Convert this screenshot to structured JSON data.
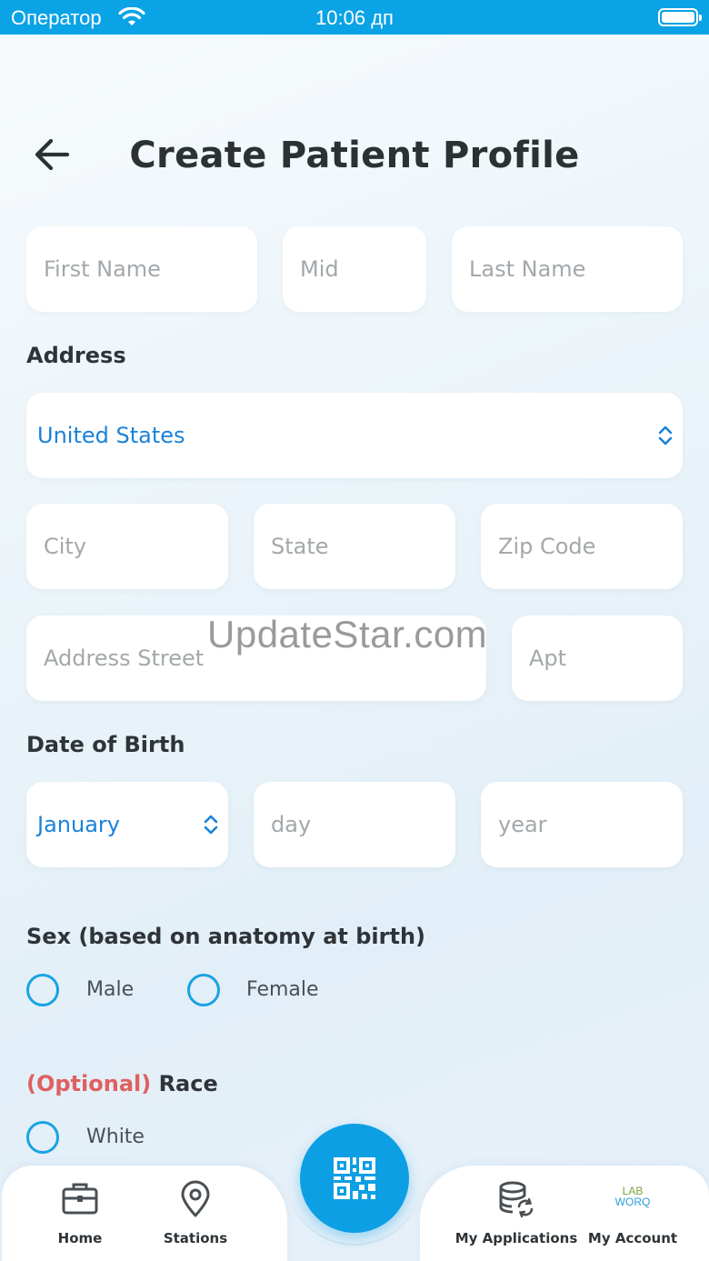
{
  "status_bar": {
    "carrier": "Оператор",
    "time": "10:06 дп"
  },
  "header": {
    "title": "Create Patient Profile"
  },
  "name_fields": {
    "first_name_placeholder": "First Name",
    "middle_placeholder": "Mid",
    "last_name_placeholder": "Last Name"
  },
  "address": {
    "label": "Address",
    "country_selected": "United States",
    "city_placeholder": "City",
    "state_placeholder": "State",
    "zip_placeholder": "Zip Code",
    "street_placeholder": "Address Street",
    "apt_placeholder": "Apt"
  },
  "dob": {
    "label": "Date of Birth",
    "month_selected": "January",
    "day_placeholder": "day",
    "year_placeholder": "year"
  },
  "sex": {
    "label": "Sex (based on anatomy at birth)",
    "options": [
      "Male",
      "Female"
    ]
  },
  "race": {
    "optional_tag": "(Optional)",
    "label": "Race",
    "options": [
      "White"
    ]
  },
  "watermark": "UpdateStar.com",
  "tabbar": {
    "items": [
      "Home",
      "Stations",
      "My Applications",
      "My Account"
    ],
    "logo_top": "LAB",
    "logo_bottom": "WORQ"
  },
  "colors": {
    "status_bar": "#0aa3e6",
    "accent": "#1a82d9",
    "radio": "#19a3e3",
    "optional": "#e06060",
    "scan_button": "#0d9fe3"
  }
}
